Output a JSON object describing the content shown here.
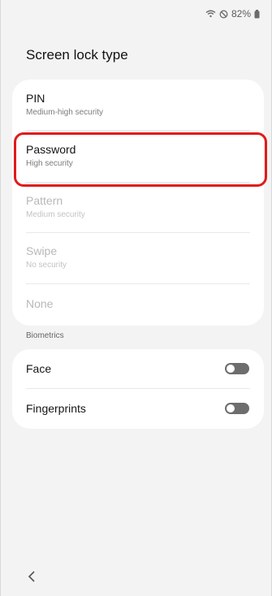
{
  "status": {
    "battery": "82%",
    "wifi_icon": "wifi-icon",
    "dnd_icon": "do-not-disturb-icon",
    "battery_icon": "battery-icon"
  },
  "page": {
    "title": "Screen lock type"
  },
  "lock_types": [
    {
      "label": "PIN",
      "description": "Medium-high security",
      "enabled": true
    },
    {
      "label": "Password",
      "description": "High security",
      "enabled": true,
      "highlighted": true
    },
    {
      "label": "Pattern",
      "description": "Medium security",
      "enabled": false
    },
    {
      "label": "Swipe",
      "description": "No security",
      "enabled": false
    },
    {
      "label": "None",
      "description": "",
      "enabled": false
    }
  ],
  "biometrics": {
    "header": "Biometrics",
    "items": [
      {
        "label": "Face",
        "enabled": false
      },
      {
        "label": "Fingerprints",
        "enabled": false
      }
    ]
  },
  "nav": {
    "back_icon": "back-chevron-icon"
  },
  "colors": {
    "highlight": "#e11a1a",
    "toggle_off": "#6d6d6d"
  }
}
